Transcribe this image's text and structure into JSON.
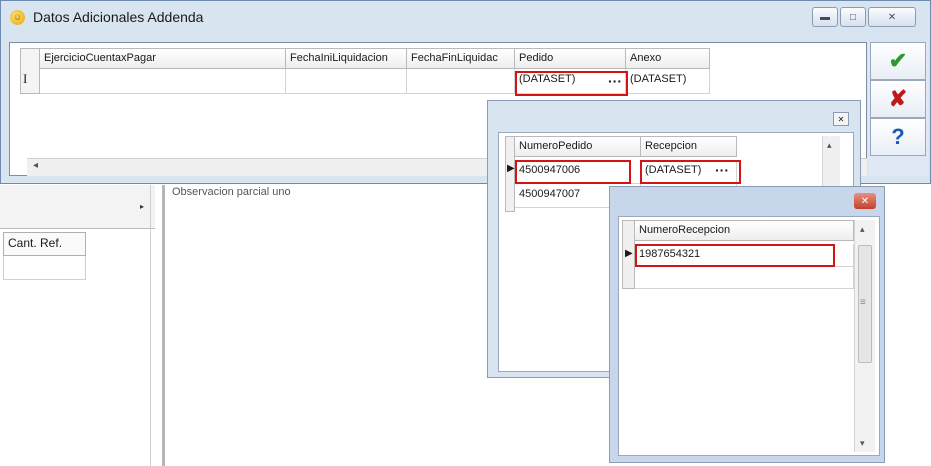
{
  "window": {
    "title": "Datos Adicionales Addenda",
    "minimize_icon": "minimize-icon",
    "maximize_icon": "maximize-icon",
    "close_icon": "close-icon"
  },
  "main_grid": {
    "columns": [
      "EjercicioCuentaxPagar",
      "FechaIniLiquidacion",
      "FechaFinLiquidac",
      "Pedido",
      "Anexo"
    ],
    "row": {
      "ejercicio": "",
      "fecha_ini": "",
      "fecha_fin": "",
      "pedido": "(DATASET)",
      "pedido_ellipsis": "···",
      "anexo": "(DATASET)"
    },
    "row_indicator": "I",
    "scroll_left": "◂",
    "scroll_right": "▸"
  },
  "actions": {
    "accept_icon": "✔",
    "cancel_icon": "✘",
    "help_icon": "?"
  },
  "pedido_window": {
    "close_icon": "✕",
    "columns": [
      "NumeroPedido",
      "Recepcion"
    ],
    "rows": [
      {
        "numero": "4500947006",
        "recepcion": "(DATASET)",
        "ellipsis": "···"
      },
      {
        "numero": "4500947007",
        "recepcion": "",
        "ellipsis": ""
      }
    ],
    "pointer": "▶",
    "scroll_up": "▴"
  },
  "recepcion_window": {
    "close_icon": "✕",
    "column": "NumeroRecepcion",
    "rows": [
      "1987654321",
      ""
    ],
    "pointer": "▶",
    "scroll_up": "▴",
    "scroll_down": "▾",
    "scroll_grip": "≡"
  },
  "background": {
    "cant_ref": "Cant. Ref.",
    "hidden_text": "Observacion parcial uno"
  },
  "colors": {
    "highlight": "#d21414",
    "title_bar": "#d9e4f1",
    "accept": "#2b9a2b",
    "cancel": "#c01818",
    "help": "#1c58b8"
  }
}
